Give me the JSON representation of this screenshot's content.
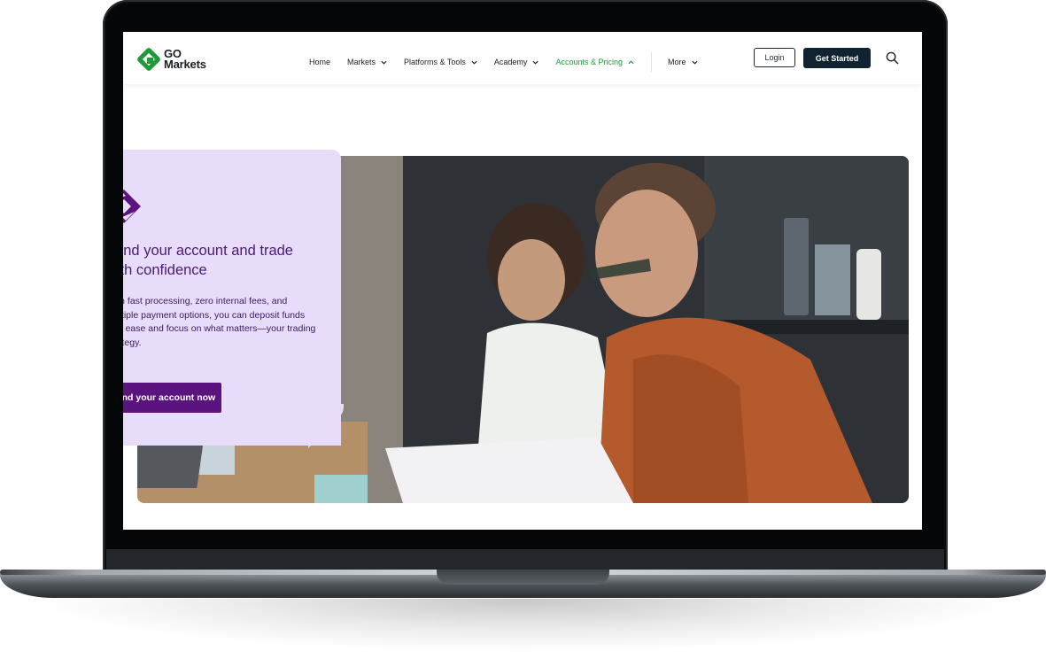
{
  "header": {
    "logo_line1": "GO",
    "logo_line2": "Markets",
    "nav": [
      {
        "label": "Home"
      },
      {
        "label": "Markets"
      },
      {
        "label": "Platforms & Tools"
      },
      {
        "label": "Academy"
      },
      {
        "label": "Accounts & Pricing"
      },
      {
        "label": "More"
      }
    ],
    "login_label": "Login",
    "get_started_label": "Get Started"
  },
  "hero": {
    "title": "Fund your account and trade with confidence",
    "description": "With fast processing, zero internal fees, and multiple payment options, you can deposit funds with ease and focus on what matters—your trading strategy.",
    "cta_label": "Fund your account now"
  },
  "colors": {
    "brand_green": "#1e9a3a",
    "navy": "#0f2430",
    "purple": "#5a137f",
    "card_lilac": "#e8dcfb"
  },
  "icons": [
    "go-markets-logo-icon",
    "chevron-down-icon",
    "chevron-up-icon",
    "search-icon",
    "deposit-brand-icon"
  ]
}
